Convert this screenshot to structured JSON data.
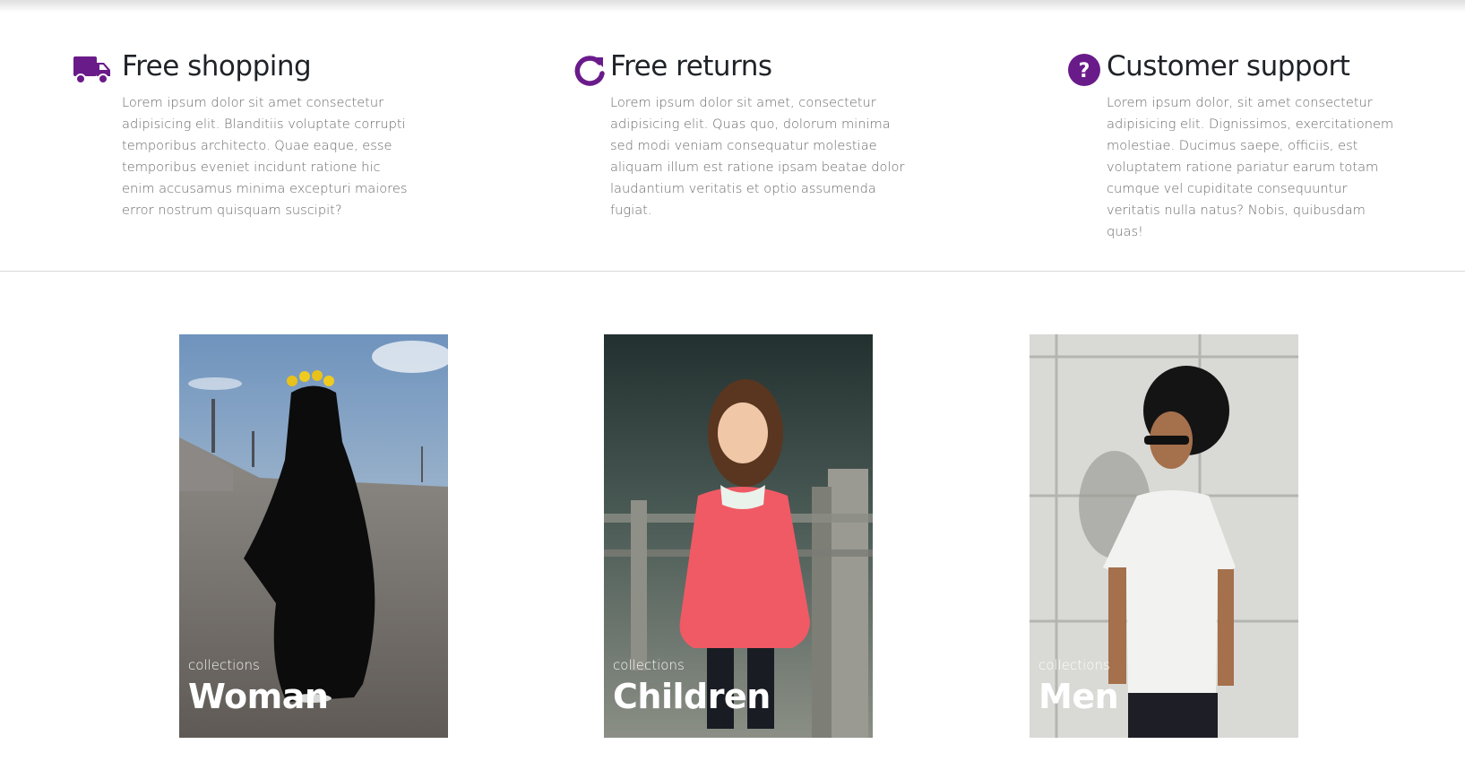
{
  "colors": {
    "accent": "#6a1b8a",
    "heading": "#1f2328",
    "body_text": "#6b6b6b",
    "divider": "#d9d9d9"
  },
  "features": [
    {
      "icon": "truck-icon",
      "title": "Free shopping",
      "text": "Lorem ipsum dolor sit amet consectetur adipisicing elit. Blanditiis voluptate corrupti temporibus architecto. Quae eaque, esse temporibus eveniet incidunt ratione hic enim accusamus minima excepturi maiores error nostrum quisquam suscipit?"
    },
    {
      "icon": "redo-arrow-icon",
      "title": "Free returns",
      "text": "Lorem ipsum dolor sit amet, consectetur adipisicing elit. Quas quo, dolorum minima sed modi veniam consequatur molestiae aliquam illum est ratione ipsam beatae dolor laudantium veritatis et optio assumenda fugiat."
    },
    {
      "icon": "question-circle-icon",
      "title": "Customer support",
      "text": "Lorem ipsum dolor, sit amet consectetur adipisicing elit. Dignissimos, exercitationem molestiae. Ducimus saepe, officiis, est voluptatem ratione pariatur earum totam cumque vel cupiditate consequuntur veritatis nulla natus? Nobis, quibusdam quas!"
    }
  ],
  "collections": [
    {
      "eyebrow": "collections",
      "name": "Woman"
    },
    {
      "eyebrow": "collections",
      "name": "Children"
    },
    {
      "eyebrow": "collections",
      "name": "Men"
    }
  ]
}
